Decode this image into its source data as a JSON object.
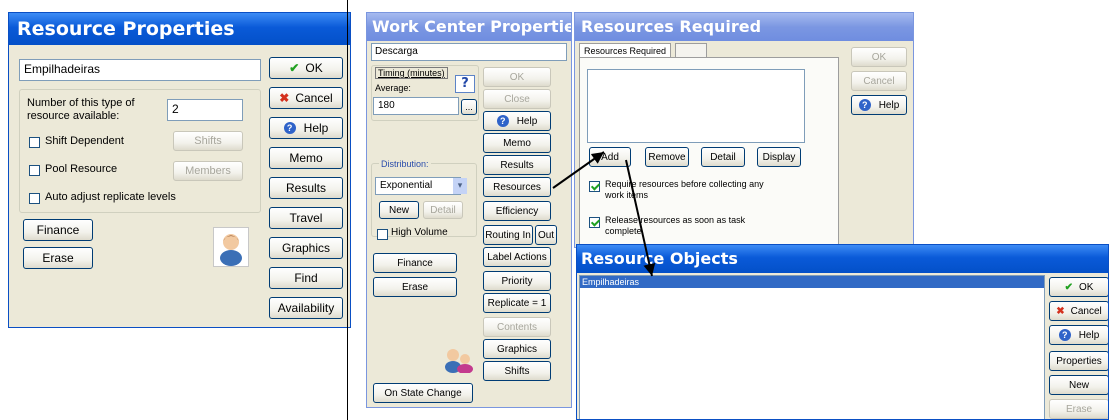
{
  "resource_properties": {
    "title": "Resource Properties",
    "name_value": "Empilhadeiras",
    "count_label": "Number of this type of resource available:",
    "count_value": "2",
    "shift_dependent": "Shift Dependent",
    "shifts_button": "Shifts",
    "pool_resource": "Pool Resource",
    "members_button": "Members",
    "auto_adjust": "Auto adjust replicate levels",
    "finance": "Finance",
    "erase": "Erase",
    "ok": "OK",
    "cancel": "Cancel",
    "help": "Help",
    "memo": "Memo",
    "results": "Results",
    "travel": "Travel",
    "graphics": "Graphics",
    "find": "Find",
    "availability": "Availability"
  },
  "work_center": {
    "title": "Work Center Properties",
    "name_value": "Descarga",
    "timing_label": "Timing (minutes)",
    "average_label": "Average:",
    "average_value": "180",
    "ellipsis": "...",
    "distribution_label": "Distribution:",
    "distribution_value": "Exponential",
    "new": "New",
    "detail": "Detail",
    "high_volume": "High Volume",
    "finance": "Finance",
    "erase": "Erase",
    "on_state_change": "On State Change",
    "ok": "OK",
    "close": "Close",
    "help": "Help",
    "memo": "Memo",
    "results": "Results",
    "resources": "Resources",
    "efficiency": "Efficiency",
    "routing_in": "Routing In",
    "out": "Out",
    "label_actions": "Label Actions",
    "priority": "Priority",
    "replicate": "Replicate = 1",
    "contents": "Contents",
    "graphics": "Graphics",
    "shifts": "Shifts"
  },
  "resources_required": {
    "title": "Resources Required",
    "tab_label": "Resources Required",
    "add": "Add",
    "remove": "Remove",
    "detail": "Detail",
    "display": "Display",
    "require_check": "Require resources before collecting any work items",
    "release_check": "Release resources as soon as task complete",
    "ok": "OK",
    "cancel": "Cancel",
    "help": "Help"
  },
  "resource_objects": {
    "title": "Resource Objects",
    "items": [
      "Empilhadeiras"
    ],
    "ok": "OK",
    "cancel": "Cancel",
    "help": "Help",
    "properties": "Properties",
    "new": "New",
    "erase": "Erase"
  },
  "colors": {
    "title_blue": "#0a5ad8",
    "dialog_bg": "#ece9d8",
    "selection": "#316ac5"
  }
}
